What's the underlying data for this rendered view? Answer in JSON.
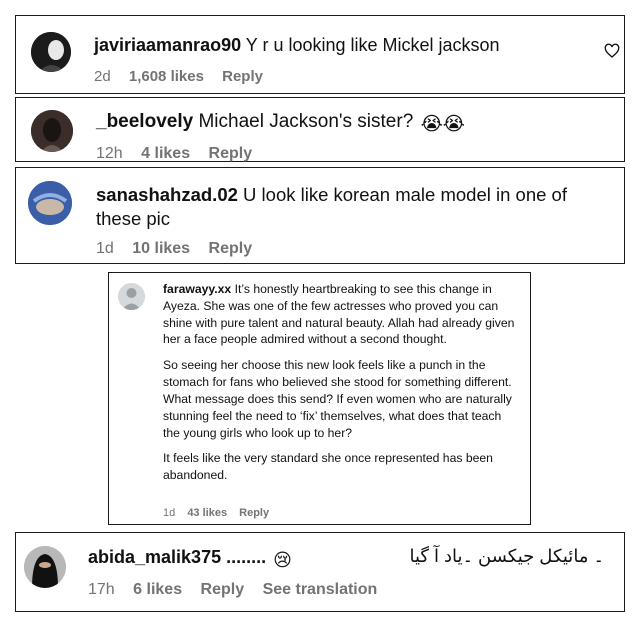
{
  "comments": [
    {
      "username": "javiriaamanrao90",
      "text": "Y r u looking like Mickel jackson",
      "time": "2d",
      "likes": "1,608 likes",
      "reply": "Reply",
      "heart_icon": "heart-outline-icon"
    },
    {
      "username": "_beelovely",
      "text": "Michael Jackson's sister?",
      "emoji": "😭😭",
      "time": "12h",
      "likes": "4 likes",
      "reply": "Reply"
    },
    {
      "username": "sanashahzad.02",
      "text": "U look like korean male model in one of these pic",
      "time": "1d",
      "likes": "10 likes",
      "reply": "Reply"
    },
    {
      "username": "farawayy.xx",
      "paragraphs": [
        "It’s honestly heartbreaking to see this change in Ayeza. She was one of the few actresses who proved you can shine with pure talent and natural beauty. Allah had already given her a face people admired without a second thought.",
        "So seeing her choose this new look feels like a punch in the stomach for fans who believed she stood for something different. What message does this send? If even women who are naturally stunning feel the need to ‘fix’ themselves, what does that teach the young girls who look up to her?",
        "It feels like the very standard she once represented has been abandoned."
      ],
      "time": "1d",
      "likes": "43 likes",
      "reply": "Reply"
    },
    {
      "username": "abida_malik375",
      "text": "........",
      "emoji": "😢",
      "urdu_text": "۔ مائیکل جیکسن ۔یاد آ گیا",
      "time": "17h",
      "likes": "6 likes",
      "reply": "Reply",
      "see_translation": "See translation"
    }
  ]
}
